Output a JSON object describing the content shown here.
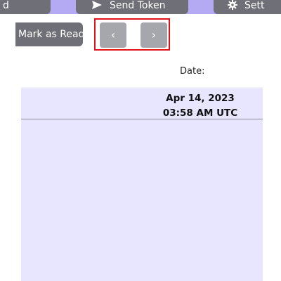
{
  "toolbar": {
    "read_label": "d",
    "send_token_label": "Send Token",
    "settings_label": "Sett"
  },
  "actions": {
    "mark_as_read_label": "Mark as Read",
    "prev_icon": "‹",
    "next_icon": "›"
  },
  "table": {
    "date_header": "Date:",
    "rows": [
      {
        "date": "Apr 14, 2023",
        "time": "03:58 AM UTC"
      }
    ]
  },
  "colors": {
    "header_bg": "#b3aaf3",
    "button_bg": "#6f6f78",
    "nav_button_bg": "#a6a6ad",
    "content_bg": "#e7e6fe",
    "highlight_border": "#e2121b"
  }
}
